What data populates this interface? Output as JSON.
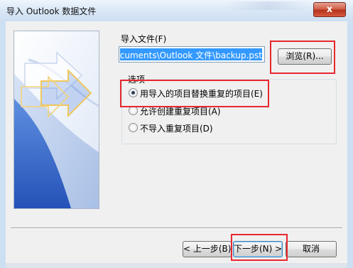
{
  "window": {
    "title": "导入 Outlook 数据文件",
    "close_label": "x"
  },
  "form": {
    "import_file_label": "导入文件(F)",
    "file_path_value": "ocuments\\Outlook 文件\\backup.pst",
    "browse_label": "浏览(R)..."
  },
  "options": {
    "group_title": "选项",
    "items": [
      {
        "label": "用导入的项目替换重复的项目(E)",
        "checked": true
      },
      {
        "label": "允许创建重复项目(A)",
        "checked": false
      },
      {
        "label": "不导入重复项目(D)",
        "checked": false
      }
    ]
  },
  "footer": {
    "back_label": "< 上一步(B)",
    "next_label": "下一步(N) >",
    "cancel_label": "取消"
  },
  "colors": {
    "highlight": "#e8282f",
    "selection": "#3399ff",
    "banner_blue": "#2e63c5"
  }
}
